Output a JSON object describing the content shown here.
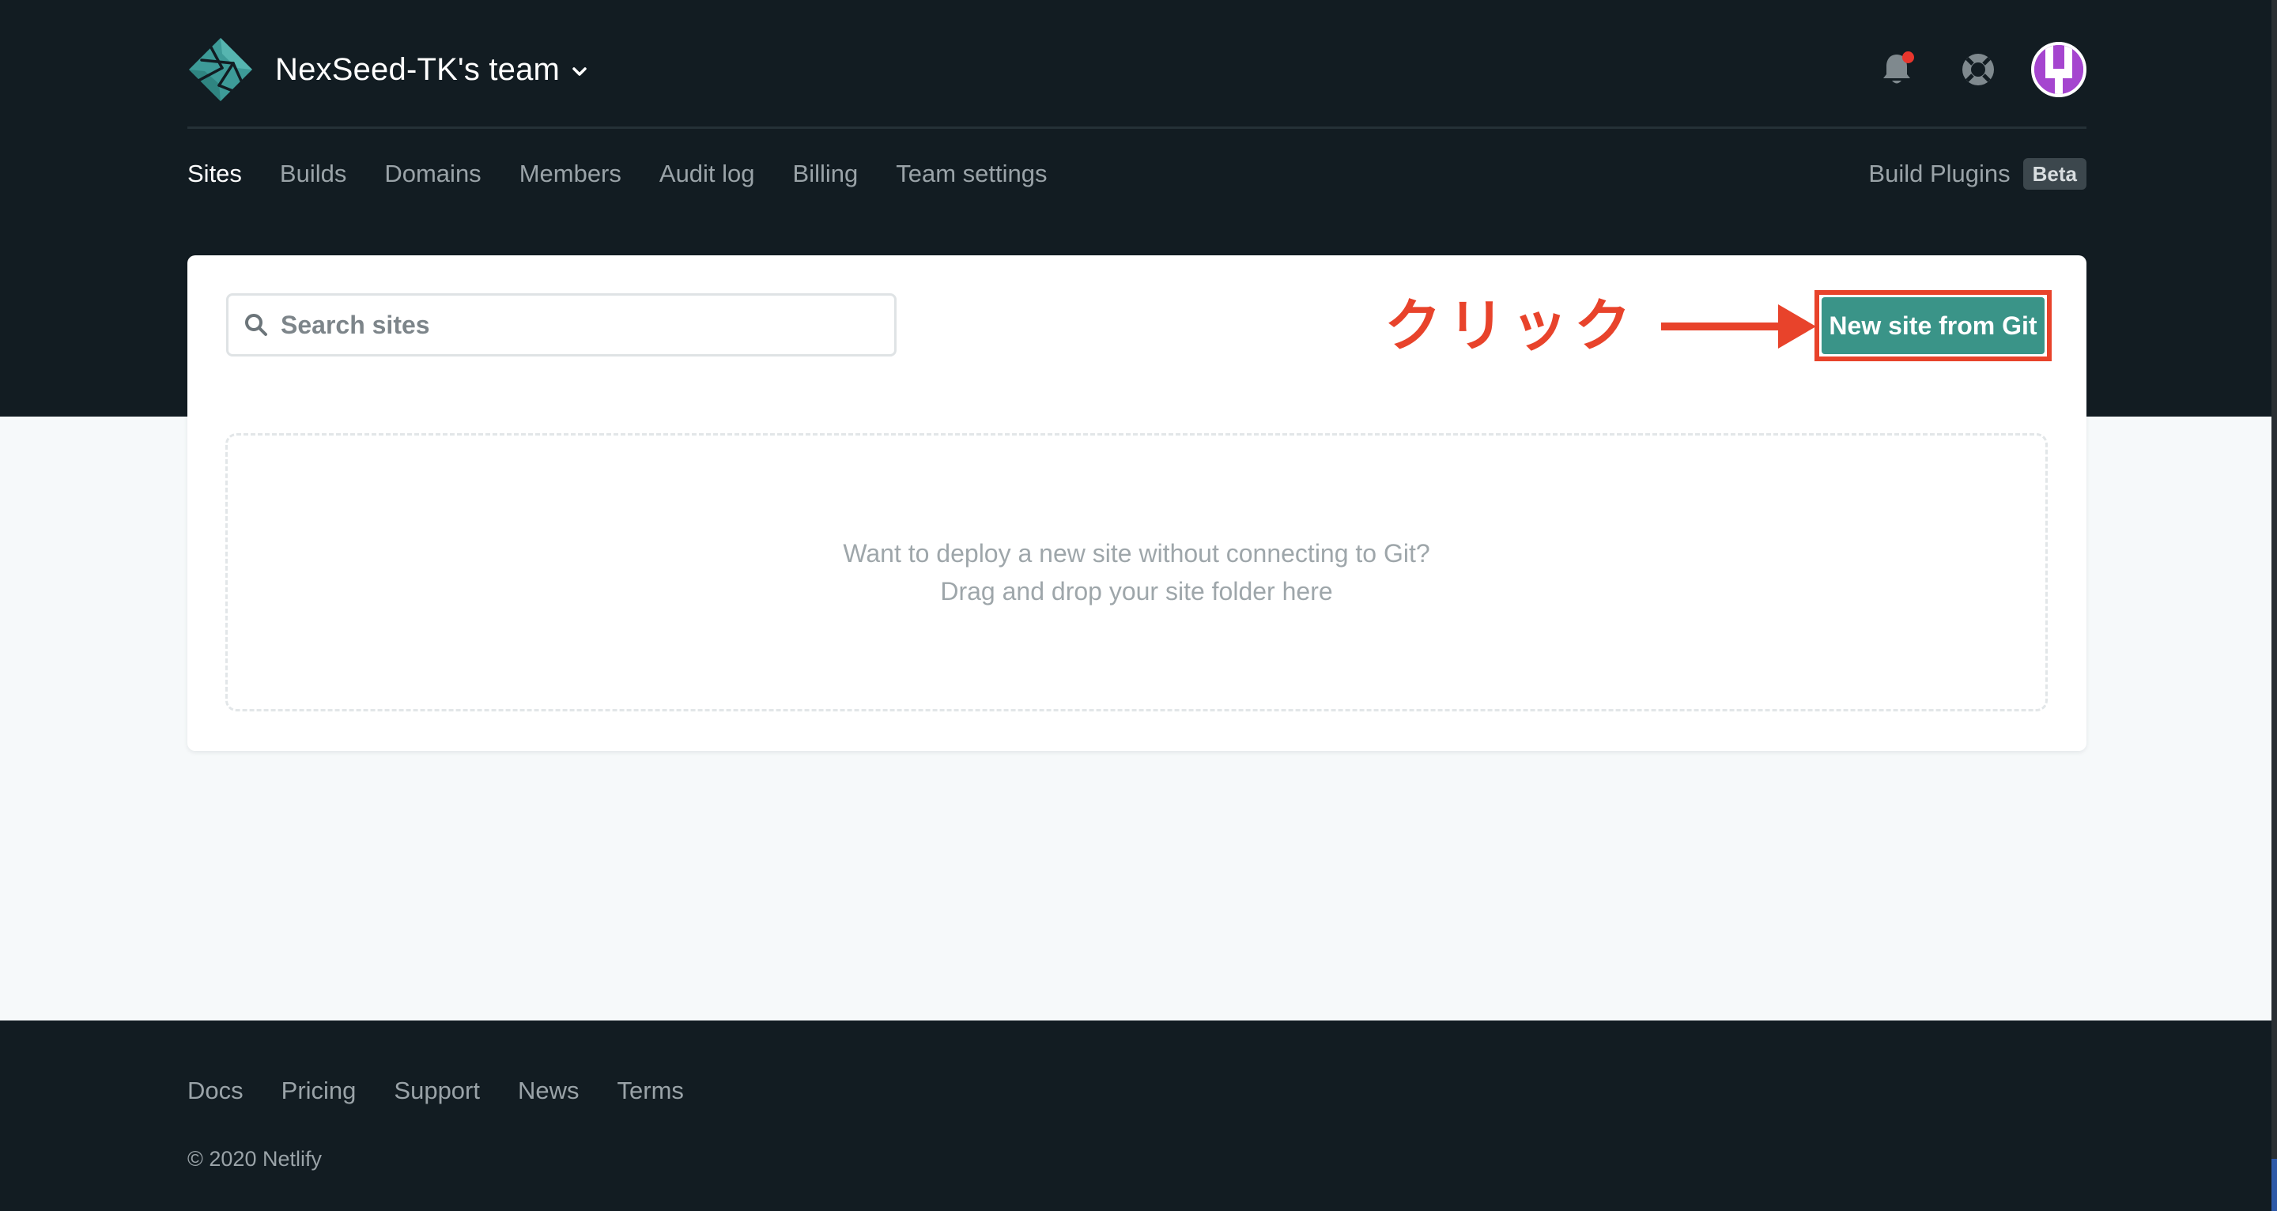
{
  "header": {
    "team_name": "NexSeed-TK's team",
    "logo_icon": "netlify-logo",
    "notifications_icon": "bell-icon",
    "help_icon": "lifebuoy-icon",
    "avatar_icon": "user-avatar"
  },
  "nav": {
    "tabs": [
      {
        "label": "Sites",
        "active": true
      },
      {
        "label": "Builds",
        "active": false
      },
      {
        "label": "Domains",
        "active": false
      },
      {
        "label": "Members",
        "active": false
      },
      {
        "label": "Audit log",
        "active": false
      },
      {
        "label": "Billing",
        "active": false
      },
      {
        "label": "Team settings",
        "active": false
      }
    ],
    "build_plugins_label": "Build Plugins",
    "beta_badge": "Beta"
  },
  "main": {
    "search_placeholder": "Search sites",
    "search_value": "",
    "new_site_button": "New site from Git",
    "annotation_text": "クリック",
    "dropzone_line1": "Want to deploy a new site without connecting to Git?",
    "dropzone_line2": "Drag and drop your site folder here"
  },
  "footer": {
    "links": [
      "Docs",
      "Pricing",
      "Support",
      "News",
      "Terms"
    ],
    "copyright": "© 2020 Netlify"
  },
  "colors": {
    "header_bg": "#121c22",
    "page_bg": "#f6f9fa",
    "primary_button": "#3a9488",
    "annotation_red": "#e8432b",
    "notification_dot": "#e8362d",
    "avatar_bg": "#a545cf"
  }
}
